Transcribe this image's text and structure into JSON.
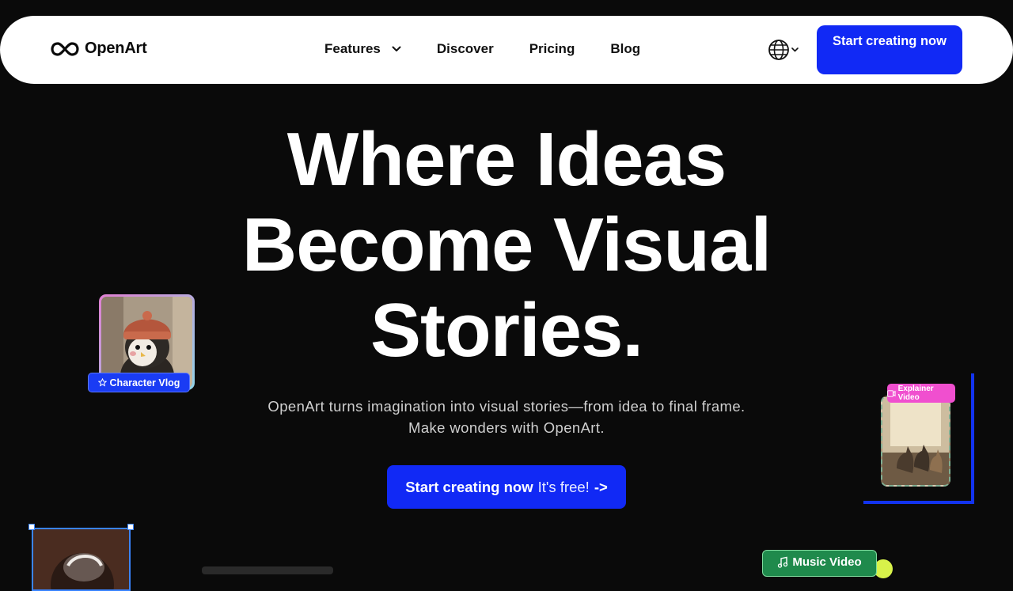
{
  "brand": {
    "name": "OpenArt"
  },
  "nav": {
    "links": [
      {
        "label": "Features"
      },
      {
        "label": "Discover"
      },
      {
        "label": "Pricing"
      },
      {
        "label": "Blog"
      }
    ],
    "cta": "Start creating now"
  },
  "hero": {
    "title_lines": [
      "Where Ideas",
      "Become Visual",
      "Stories."
    ],
    "subtitle_lines": [
      "OpenArt turns imagination into visual stories—from idea to final frame.",
      "Make wonders with OpenArt."
    ],
    "cta_bold": "Start creating now",
    "cta_light": "It's free!",
    "cta_arrow": "->"
  },
  "cards": {
    "character_vlog": "Character Vlog",
    "explainer_video": "Explainer Video",
    "music_video": "Music Video"
  },
  "colors": {
    "accent": "#1129f5",
    "background": "#0a0a0a",
    "pink": "#f04fcf",
    "green": "#1f8a4c"
  },
  "icons": [
    "infinity-logo-icon",
    "chevron-down-icon",
    "globe-icon",
    "star-icon",
    "video-icon",
    "music-note-icon"
  ]
}
